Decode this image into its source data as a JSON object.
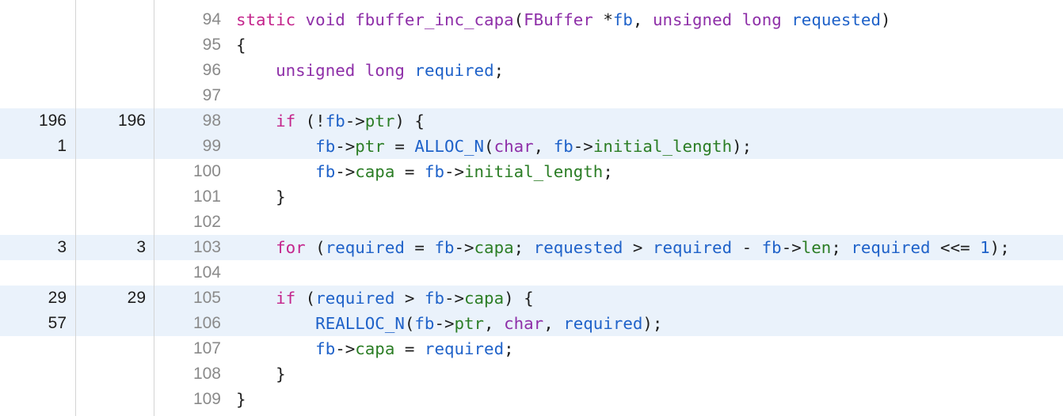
{
  "colors": {
    "keyword": "#c4258c",
    "type": "#8e2fa8",
    "identifier": "#1f62c9",
    "member": "#2b7d25",
    "plain": "#1e1e1e",
    "highlight_row": "#eaf2fb",
    "line_number": "#8a8a8a"
  },
  "lines": [
    {
      "line": "94",
      "count1": "",
      "count2": "",
      "highlight": false,
      "tokens": [
        {
          "t": "static",
          "c": "keyword"
        },
        {
          "t": " "
        },
        {
          "t": "void",
          "c": "type"
        },
        {
          "t": " "
        },
        {
          "t": "fbuffer_inc_capa",
          "c": "type"
        },
        {
          "t": "("
        },
        {
          "t": "FBuffer",
          "c": "type"
        },
        {
          "t": " *"
        },
        {
          "t": "fb",
          "c": "identifier"
        },
        {
          "t": ", "
        },
        {
          "t": "unsigned",
          "c": "type"
        },
        {
          "t": " "
        },
        {
          "t": "long",
          "c": "type"
        },
        {
          "t": " "
        },
        {
          "t": "requested",
          "c": "identifier"
        },
        {
          "t": ")"
        }
      ]
    },
    {
      "line": "95",
      "count1": "",
      "count2": "",
      "highlight": false,
      "tokens": [
        {
          "t": "{"
        }
      ]
    },
    {
      "line": "96",
      "count1": "",
      "count2": "",
      "highlight": false,
      "tokens": [
        {
          "t": "    "
        },
        {
          "t": "unsigned",
          "c": "type"
        },
        {
          "t": " "
        },
        {
          "t": "long",
          "c": "type"
        },
        {
          "t": " "
        },
        {
          "t": "required",
          "c": "identifier"
        },
        {
          "t": ";"
        }
      ]
    },
    {
      "line": "97",
      "count1": "",
      "count2": "",
      "highlight": false,
      "tokens": []
    },
    {
      "line": "98",
      "count1": "196",
      "count2": "196",
      "highlight": true,
      "tokens": [
        {
          "t": "    "
        },
        {
          "t": "if",
          "c": "keyword"
        },
        {
          "t": " (!"
        },
        {
          "t": "fb",
          "c": "identifier"
        },
        {
          "t": "->"
        },
        {
          "t": "ptr",
          "c": "member"
        },
        {
          "t": ") {"
        }
      ]
    },
    {
      "line": "99",
      "count1": "1",
      "count2": "",
      "highlight": true,
      "tokens": [
        {
          "t": "        "
        },
        {
          "t": "fb",
          "c": "identifier"
        },
        {
          "t": "->"
        },
        {
          "t": "ptr",
          "c": "member"
        },
        {
          "t": " = "
        },
        {
          "t": "ALLOC_N",
          "c": "identifier"
        },
        {
          "t": "("
        },
        {
          "t": "char",
          "c": "type"
        },
        {
          "t": ", "
        },
        {
          "t": "fb",
          "c": "identifier"
        },
        {
          "t": "->"
        },
        {
          "t": "initial_length",
          "c": "member"
        },
        {
          "t": ");"
        }
      ]
    },
    {
      "line": "100",
      "count1": "",
      "count2": "",
      "highlight": false,
      "tokens": [
        {
          "t": "        "
        },
        {
          "t": "fb",
          "c": "identifier"
        },
        {
          "t": "->"
        },
        {
          "t": "capa",
          "c": "member"
        },
        {
          "t": " = "
        },
        {
          "t": "fb",
          "c": "identifier"
        },
        {
          "t": "->"
        },
        {
          "t": "initial_length",
          "c": "member"
        },
        {
          "t": ";"
        }
      ]
    },
    {
      "line": "101",
      "count1": "",
      "count2": "",
      "highlight": false,
      "tokens": [
        {
          "t": "    }"
        }
      ]
    },
    {
      "line": "102",
      "count1": "",
      "count2": "",
      "highlight": false,
      "tokens": []
    },
    {
      "line": "103",
      "count1": "3",
      "count2": "3",
      "highlight": true,
      "tokens": [
        {
          "t": "    "
        },
        {
          "t": "for",
          "c": "keyword"
        },
        {
          "t": " ("
        },
        {
          "t": "required",
          "c": "identifier"
        },
        {
          "t": " = "
        },
        {
          "t": "fb",
          "c": "identifier"
        },
        {
          "t": "->"
        },
        {
          "t": "capa",
          "c": "member"
        },
        {
          "t": "; "
        },
        {
          "t": "requested",
          "c": "identifier"
        },
        {
          "t": " > "
        },
        {
          "t": "required",
          "c": "identifier"
        },
        {
          "t": " - "
        },
        {
          "t": "fb",
          "c": "identifier"
        },
        {
          "t": "->"
        },
        {
          "t": "len",
          "c": "member"
        },
        {
          "t": "; "
        },
        {
          "t": "required",
          "c": "identifier"
        },
        {
          "t": " <<= "
        },
        {
          "t": "1",
          "c": "identifier"
        },
        {
          "t": ");"
        }
      ]
    },
    {
      "line": "104",
      "count1": "",
      "count2": "",
      "highlight": false,
      "tokens": []
    },
    {
      "line": "105",
      "count1": "29",
      "count2": "29",
      "highlight": true,
      "tokens": [
        {
          "t": "    "
        },
        {
          "t": "if",
          "c": "keyword"
        },
        {
          "t": " ("
        },
        {
          "t": "required",
          "c": "identifier"
        },
        {
          "t": " > "
        },
        {
          "t": "fb",
          "c": "identifier"
        },
        {
          "t": "->"
        },
        {
          "t": "capa",
          "c": "member"
        },
        {
          "t": ") {"
        }
      ]
    },
    {
      "line": "106",
      "count1": "57",
      "count2": "",
      "highlight": true,
      "tokens": [
        {
          "t": "        "
        },
        {
          "t": "REALLOC_N",
          "c": "identifier"
        },
        {
          "t": "("
        },
        {
          "t": "fb",
          "c": "identifier"
        },
        {
          "t": "->"
        },
        {
          "t": "ptr",
          "c": "member"
        },
        {
          "t": ", "
        },
        {
          "t": "char",
          "c": "type"
        },
        {
          "t": ", "
        },
        {
          "t": "required",
          "c": "identifier"
        },
        {
          "t": ");"
        }
      ]
    },
    {
      "line": "107",
      "count1": "",
      "count2": "",
      "highlight": false,
      "tokens": [
        {
          "t": "        "
        },
        {
          "t": "fb",
          "c": "identifier"
        },
        {
          "t": "->"
        },
        {
          "t": "capa",
          "c": "member"
        },
        {
          "t": " = "
        },
        {
          "t": "required",
          "c": "identifier"
        },
        {
          "t": ";"
        }
      ]
    },
    {
      "line": "108",
      "count1": "",
      "count2": "",
      "highlight": false,
      "tokens": [
        {
          "t": "    }"
        }
      ]
    },
    {
      "line": "109",
      "count1": "",
      "count2": "",
      "highlight": false,
      "tokens": [
        {
          "t": "}"
        }
      ]
    }
  ]
}
